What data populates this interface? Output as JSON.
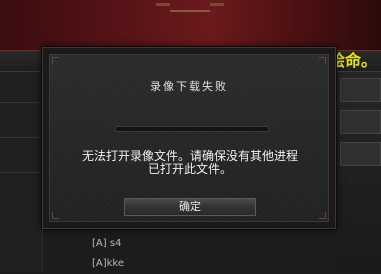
{
  "background": {
    "strip_text": "绘命。",
    "list": [
      "[A] s4",
      "[A]kke"
    ]
  },
  "dialog": {
    "title": "录像下载失败",
    "message_line1": "无法打开录像文件。请确保没有其他进程",
    "message_line2": "已打开此文件。",
    "ok_label": "确定",
    "progress": 0
  },
  "colors": {
    "banner": "#5a1418",
    "strip_text": "#e8e020",
    "dialog_bg": "#252525"
  }
}
